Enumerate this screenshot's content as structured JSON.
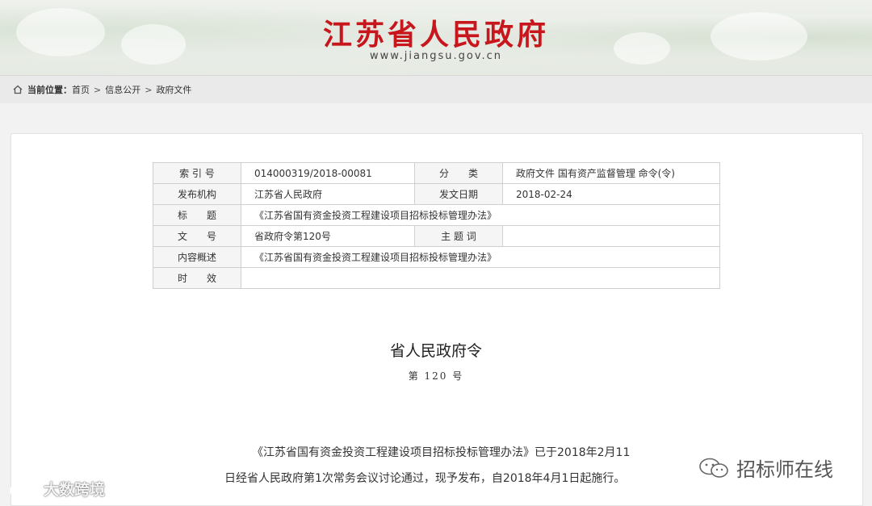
{
  "header": {
    "title": "江苏省人民政府",
    "url": "www.jiangsu.gov.cn"
  },
  "breadcrumb": {
    "label": "当前位置：",
    "items": [
      "首页",
      "信息公开",
      "政府文件"
    ],
    "separator": ">"
  },
  "meta": {
    "index_label": "索 引 号",
    "index_value": "014000319/2018-00081",
    "category_label": "分　　类",
    "category_value": "政府文件 国有资产监督管理 命令(令)",
    "issuer_label": "发布机构",
    "issuer_value": "江苏省人民政府",
    "date_label": "发文日期",
    "date_value": "2018-02-24",
    "title_label": "标　　题",
    "title_value": "《江苏省国有资金投资工程建设项目招标投标管理办法》",
    "docno_label": "文　　号",
    "docno_value": "省政府令第120号",
    "subject_label": "主 题 词",
    "subject_value": "",
    "summary_label": "内容概述",
    "summary_value": "《江苏省国有资金投资工程建设项目招标投标管理办法》",
    "validity_label": "时　　效",
    "validity_value": ""
  },
  "document": {
    "heading": "省人民政府令",
    "number": "第 120 号",
    "line1": "《江苏省国有资金投资工程建设项目招标投标管理办法》已于2018年2月11",
    "line2": "日经省人民政府第1次常务会议讨论通过，现予发布，自2018年4月1日起施行。"
  },
  "watermarks": {
    "left": "大数跨境",
    "right": "招标师在线"
  }
}
